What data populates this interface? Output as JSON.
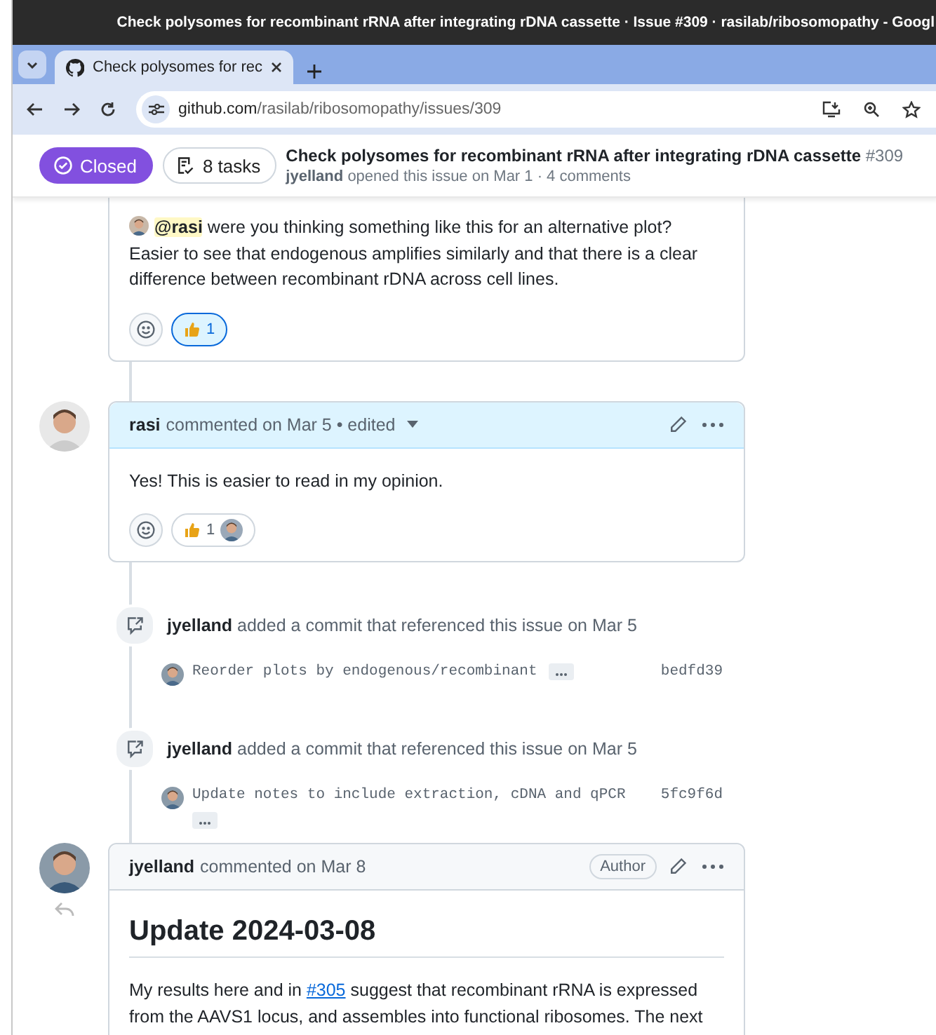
{
  "window": {
    "title": "Check polysomes for recombinant rRNA after integrating rDNA cassette · Issue #309 · rasilab/ribosomopathy - Googl"
  },
  "tabs": [
    {
      "label": "Check polysomes for rec",
      "selected": true
    }
  ],
  "address": {
    "domain": "github.com",
    "path": "/rasilab/ribosomopathy/issues/309"
  },
  "issue": {
    "state": "Closed",
    "tasks": "8 tasks",
    "title": "Check polysomes for recombinant rRNA after integrating rDNA cassette",
    "number": "#309",
    "author": "jyelland",
    "meta": "opened this issue on Mar 1 · 4 comments"
  },
  "timeline": [
    {
      "kind": "comment-tail",
      "body": [
        {
          "kind": "mention",
          "text": "@rasi"
        },
        {
          "kind": "text",
          "text": " were you thinking something like this for an alternative plot? Easier to see that endogenous amplifies similarly and that there is a clear difference between recombinant rDNA across cell lines."
        }
      ],
      "reactions": [
        {
          "count": "1",
          "selected": true,
          "users": false
        }
      ]
    },
    {
      "kind": "comment",
      "author": "rasi",
      "action": "commented on Mar 5 • edited",
      "highlighted": true,
      "body": [
        {
          "kind": "text",
          "text": "Yes! This is easier to read in my opinion."
        }
      ],
      "reactions": [
        {
          "count": "1",
          "selected": false,
          "users": true
        }
      ]
    },
    {
      "kind": "commit",
      "author": "jyelland",
      "action": "added a commit that referenced this issue on Mar 5",
      "message": "Reorder plots by endogenous/recombinant",
      "sha": "bedfd39"
    },
    {
      "kind": "commit",
      "author": "jyelland",
      "action": "added a commit that referenced this issue on Mar 5",
      "message": "Update notes to include extraction, cDNA and qPCR",
      "sha": "5fc9f6d"
    },
    {
      "kind": "comment",
      "author": "jyelland",
      "action": "commented on Mar 8",
      "highlighted": false,
      "author_badge": "Author",
      "heading": "Update 2024-03-08",
      "body": [
        {
          "kind": "text",
          "text": "My results here and in "
        },
        {
          "kind": "link",
          "text": "#305"
        },
        {
          "kind": "text",
          "text": " suggest that recombinant rRNA is expressed from the AAVS1 locus, and assembles into functional ribosomes. The next"
        }
      ]
    }
  ]
}
